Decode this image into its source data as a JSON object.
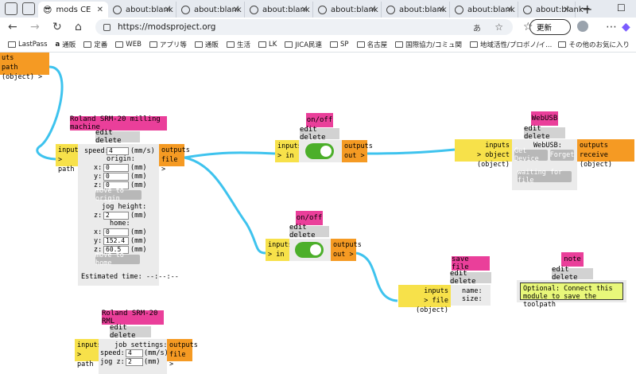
{
  "browser": {
    "tabs": [
      {
        "label": "mods CE",
        "icon": "sunglasses-emoji-icon",
        "active": true
      },
      {
        "label": "about:blank",
        "icon": "globe-icon"
      },
      {
        "label": "about:blank",
        "icon": "globe-icon"
      },
      {
        "label": "about:blank",
        "icon": "globe-icon"
      },
      {
        "label": "about:blank",
        "icon": "globe-icon"
      },
      {
        "label": "about:blank",
        "icon": "globe-icon"
      },
      {
        "label": "about:blank",
        "icon": "globe-icon"
      },
      {
        "label": "about:blank",
        "icon": "globe-icon"
      }
    ],
    "url": "https://modsproject.org",
    "reader_icon_text": "あ",
    "refresh_label": "更新",
    "bookmarks": [
      "LastPass",
      "通販",
      "定番",
      "WEB",
      "アプリ等",
      "通販",
      "生活",
      "LK",
      "JICA民連",
      "SP",
      "名古屋",
      "国際協力/コミュ関",
      "地域活性/プロボノ/イ..."
    ],
    "other_bookmarks": "その他のお気に入り"
  },
  "modules": {
    "top_partial": {
      "outputs": "uts",
      "path": "path (object) >"
    },
    "milling": {
      "title": "Roland SRM-20 milling machine",
      "edit": "edit delete",
      "inputs": "inputs",
      "inputs_port": "> path",
      "outputs": "outputs",
      "outputs_port": "file >",
      "speed_label": "speed:",
      "speed": "4",
      "speed_unit": "(mm/s)",
      "origin_label": "origin:",
      "x_label": "x:",
      "x": "0",
      "y_label": "y:",
      "y": "0",
      "z_label": "z:",
      "z": "0",
      "mm": "(mm)",
      "move_origin": "move to origin",
      "jog_label": "jog height:",
      "jog_z_label": "z:",
      "jog_z": "2",
      "home_label": "home:",
      "hx": "0",
      "hy": "152.4",
      "hz": "60.5",
      "move_home": "move to home",
      "estimated": "Estimated time: --:--:--"
    },
    "onoff1": {
      "title": "on/off",
      "edit": "edit delete",
      "inputs": "inputs",
      "in": "> in",
      "outputs": "outputs",
      "out": "out >"
    },
    "onoff2": {
      "title": "on/off",
      "edit": "edit delete",
      "inputs": "inputs",
      "in": "> in",
      "outputs": "outputs",
      "out": "out >"
    },
    "webusb": {
      "title": "WebUSB",
      "edit": "edit delete",
      "inputs": "inputs",
      "in": "> object (object)",
      "outputs": "outputs",
      "out": "receive (object)",
      "label": "WebUSB:",
      "get_device": "Get Device",
      "forget": "Forget",
      "status": "waiting for file"
    },
    "savefile": {
      "title": "save file",
      "edit": "edit delete",
      "inputs": "inputs",
      "in": "> file (object)",
      "name": "name:",
      "size": "size:"
    },
    "note": {
      "title": "note",
      "edit": "edit delete",
      "text": "Optional: Connect this module to save the toolpath"
    },
    "rml": {
      "title": "Roland SRM-20 RML",
      "edit": "edit delete",
      "inputs": "inputs",
      "in": "> path",
      "outputs": "outputs",
      "out": "file >",
      "job": "job settings:",
      "speed_label": "speed:",
      "speed": "4",
      "speed_unit": "(mm/s)",
      "jogz_label": "jog z:",
      "jogz": "2",
      "mm": "(mm)"
    }
  },
  "colors": {
    "title": "#ea3f9a",
    "inputs": "#f7e14a",
    "outputs": "#f59a23",
    "wire": "#3ec3ee",
    "toggle": "#4caf2a"
  }
}
